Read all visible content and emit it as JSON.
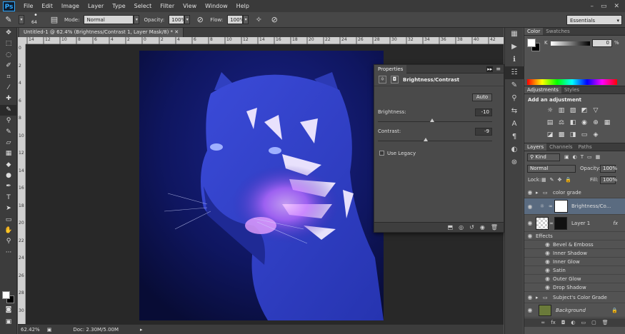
{
  "app": {
    "logo": "Ps"
  },
  "menu": [
    "File",
    "Edit",
    "Image",
    "Layer",
    "Type",
    "Select",
    "Filter",
    "View",
    "Window",
    "Help"
  ],
  "window_controls": [
    "–",
    "▭",
    "✕"
  ],
  "options": {
    "brush_size": "64",
    "mode_label": "Mode:",
    "mode_value": "Normal",
    "opacity_label": "Opacity:",
    "opacity_value": "100%",
    "flow_label": "Flow:",
    "flow_value": "100%",
    "workspace": "Essentials"
  },
  "document": {
    "tab_title": "Untitled-1 @ 62.4% (Brightness/Contrast 1, Layer Mask/8) *",
    "ruler_h": [
      "14",
      "12",
      "10",
      "8",
      "6",
      "4",
      "2",
      "0",
      "2",
      "4",
      "6",
      "8",
      "10",
      "12",
      "14",
      "16",
      "18",
      "20",
      "22",
      "24",
      "26",
      "28",
      "30",
      "32",
      "34",
      "36",
      "38",
      "40",
      "42"
    ],
    "ruler_v": [
      "0",
      "2",
      "4",
      "6",
      "8",
      "10",
      "12",
      "14",
      "16",
      "18",
      "20",
      "22",
      "24",
      "26",
      "28",
      "30"
    ]
  },
  "status": {
    "zoom": "62.42%",
    "doc": "Doc: 2.30M/5.00M"
  },
  "properties": {
    "tab": "Properties",
    "title": "Brightness/Contrast",
    "auto": "Auto",
    "brightness_label": "Brightness:",
    "brightness_value": "-10",
    "contrast_label": "Contrast:",
    "contrast_value": "-9",
    "legacy_label": "Use Legacy"
  },
  "color_panel": {
    "tabs": [
      "Color",
      "Swatches"
    ],
    "channel": "K",
    "value": "0",
    "unit": "%"
  },
  "adjustments": {
    "tabs": [
      "Adjustments",
      "Styles"
    ],
    "heading": "Add an adjustment"
  },
  "layers": {
    "tabs": [
      "Layers",
      "Channels",
      "Paths"
    ],
    "filter": "Kind",
    "blend": "Normal",
    "opacity_label": "Opacity:",
    "opacity_value": "100%",
    "lock_label": "Lock:",
    "fill_label": "Fill:",
    "fill_value": "100%",
    "rows": {
      "color_grade": "color grade",
      "bc": "Brightness/Co...",
      "layer1": "Layer 1",
      "fx": "fx",
      "effects": "Effects",
      "bevel": "Bevel & Emboss",
      "inner_shadow": "Inner Shadow",
      "inner_glow": "Inner Glow",
      "satin": "Satin",
      "outer_glow": "Outer Glow",
      "drop_shadow": "Drop Shadow",
      "subject": "Subject's Color Grade",
      "background": "Background"
    }
  },
  "colors": {
    "accent": "#31a8ff",
    "highlight_row": "#5a6b80"
  }
}
